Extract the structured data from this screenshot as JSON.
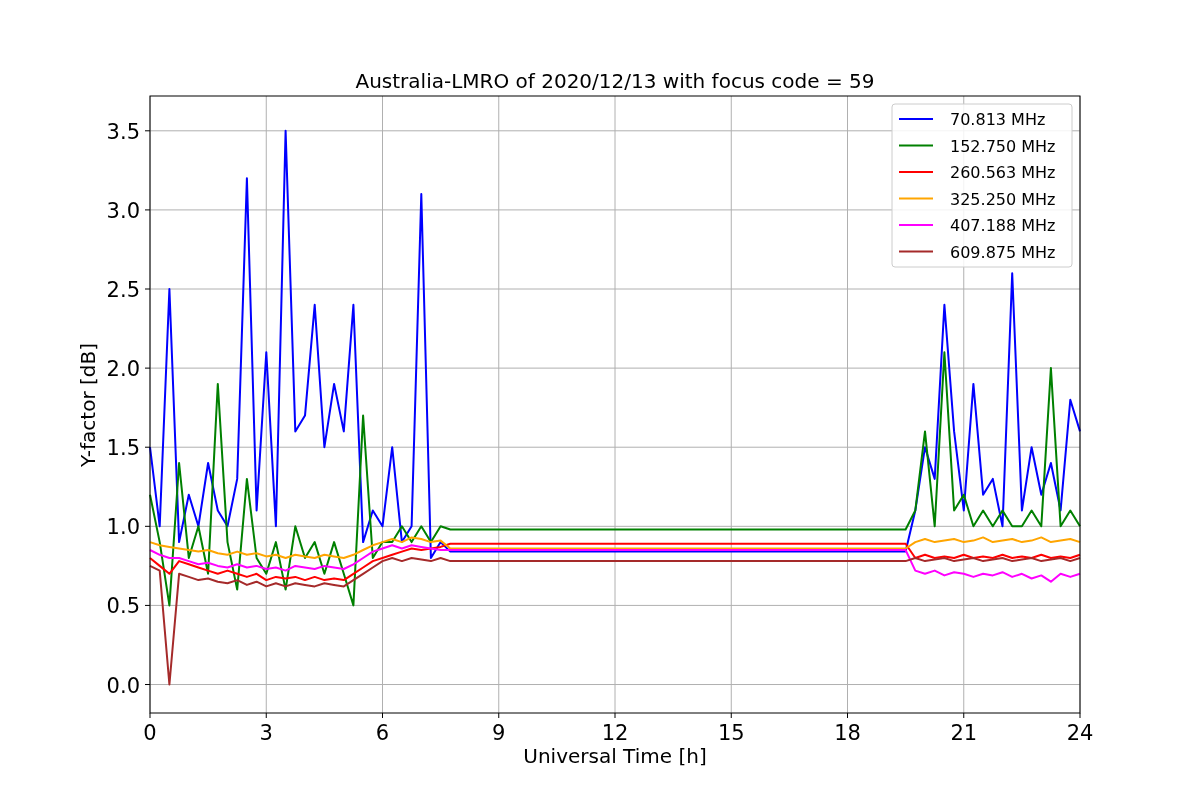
{
  "chart_data": {
    "type": "line",
    "title": "Australia-LMRO of 2020/12/13 with focus code = 59",
    "xlabel": "Universal Time [h]",
    "ylabel": "Y-factor [dB]",
    "x": [
      0,
      0.25,
      0.5,
      0.75,
      1,
      1.25,
      1.5,
      1.75,
      2,
      2.25,
      2.5,
      2.75,
      3,
      3.25,
      3.5,
      3.75,
      4,
      4.25,
      4.5,
      4.75,
      5,
      5.25,
      5.5,
      5.75,
      6,
      6.25,
      6.5,
      6.75,
      7,
      7.25,
      7.5,
      7.75,
      19.5,
      19.75,
      20,
      20.25,
      20.5,
      20.75,
      21,
      21.25,
      21.5,
      21.75,
      22,
      22.25,
      22.5,
      22.75,
      23,
      23.25,
      23.5,
      23.75,
      24
    ],
    "series": [
      {
        "name": "70.813 MHz",
        "color": "#0000ff",
        "values": [
          1.5,
          1.0,
          2.5,
          0.9,
          1.2,
          1.0,
          1.4,
          1.1,
          1.0,
          1.3,
          3.2,
          1.1,
          2.1,
          1.0,
          3.5,
          1.6,
          1.7,
          2.4,
          1.5,
          1.9,
          1.6,
          2.4,
          0.9,
          1.1,
          1.0,
          1.5,
          0.9,
          1.0,
          3.1,
          0.8,
          0.9,
          0.84,
          0.84,
          1.1,
          1.5,
          1.3,
          2.4,
          1.6,
          1.1,
          1.9,
          1.2,
          1.3,
          1.0,
          2.6,
          1.1,
          1.5,
          1.2,
          1.4,
          1.1,
          1.8,
          1.6
        ]
      },
      {
        "name": "152.750 MHz",
        "color": "#008000",
        "values": [
          1.2,
          0.9,
          0.5,
          1.4,
          0.8,
          1.0,
          0.7,
          1.9,
          0.9,
          0.6,
          1.3,
          0.8,
          0.7,
          0.9,
          0.6,
          1.0,
          0.8,
          0.9,
          0.7,
          0.9,
          0.7,
          0.5,
          1.7,
          0.8,
          0.9,
          0.9,
          1.0,
          0.9,
          1.0,
          0.9,
          1.0,
          0.98,
          0.98,
          1.1,
          1.6,
          1.0,
          2.1,
          1.1,
          1.2,
          1.0,
          1.1,
          1.0,
          1.1,
          1.0,
          1.0,
          1.1,
          1.0,
          2.0,
          1.0,
          1.1,
          1.0
        ]
      },
      {
        "name": "260.563 MHz",
        "color": "#ff0000",
        "values": [
          0.8,
          0.75,
          0.7,
          0.78,
          0.76,
          0.74,
          0.72,
          0.7,
          0.72,
          0.7,
          0.68,
          0.7,
          0.66,
          0.68,
          0.67,
          0.68,
          0.66,
          0.68,
          0.66,
          0.67,
          0.66,
          0.7,
          0.74,
          0.78,
          0.8,
          0.82,
          0.84,
          0.86,
          0.85,
          0.86,
          0.87,
          0.89,
          0.89,
          0.8,
          0.82,
          0.8,
          0.81,
          0.8,
          0.82,
          0.8,
          0.81,
          0.8,
          0.82,
          0.8,
          0.81,
          0.8,
          0.82,
          0.8,
          0.81,
          0.8,
          0.82
        ]
      },
      {
        "name": "325.250 MHz",
        "color": "#ffa500",
        "values": [
          0.9,
          0.88,
          0.87,
          0.86,
          0.85,
          0.84,
          0.85,
          0.83,
          0.82,
          0.84,
          0.82,
          0.83,
          0.81,
          0.82,
          0.8,
          0.82,
          0.81,
          0.8,
          0.82,
          0.81,
          0.8,
          0.82,
          0.85,
          0.88,
          0.9,
          0.92,
          0.9,
          0.93,
          0.92,
          0.9,
          0.91,
          0.86,
          0.86,
          0.9,
          0.92,
          0.9,
          0.91,
          0.92,
          0.9,
          0.91,
          0.93,
          0.9,
          0.91,
          0.92,
          0.9,
          0.91,
          0.93,
          0.9,
          0.91,
          0.92,
          0.9
        ]
      },
      {
        "name": "407.188 MHz",
        "color": "#ff00ff",
        "values": [
          0.85,
          0.82,
          0.8,
          0.8,
          0.78,
          0.76,
          0.77,
          0.75,
          0.74,
          0.76,
          0.74,
          0.75,
          0.73,
          0.74,
          0.72,
          0.75,
          0.74,
          0.73,
          0.75,
          0.74,
          0.73,
          0.76,
          0.8,
          0.84,
          0.86,
          0.88,
          0.86,
          0.88,
          0.87,
          0.86,
          0.85,
          0.85,
          0.85,
          0.72,
          0.7,
          0.72,
          0.69,
          0.71,
          0.7,
          0.68,
          0.7,
          0.69,
          0.71,
          0.68,
          0.7,
          0.67,
          0.69,
          0.65,
          0.7,
          0.68,
          0.7
        ]
      },
      {
        "name": "609.875 MHz",
        "color": "#a52a2a",
        "values": [
          0.75,
          0.72,
          0.0,
          0.7,
          0.68,
          0.66,
          0.67,
          0.65,
          0.64,
          0.66,
          0.63,
          0.65,
          0.62,
          0.64,
          0.62,
          0.64,
          0.63,
          0.62,
          0.64,
          0.63,
          0.62,
          0.66,
          0.7,
          0.74,
          0.78,
          0.8,
          0.78,
          0.8,
          0.79,
          0.78,
          0.8,
          0.78,
          0.78,
          0.8,
          0.78,
          0.79,
          0.8,
          0.78,
          0.79,
          0.8,
          0.78,
          0.79,
          0.8,
          0.78,
          0.79,
          0.8,
          0.78,
          0.79,
          0.8,
          0.78,
          0.8
        ]
      }
    ],
    "grid": true,
    "legend": true,
    "xlim": [
      0,
      24
    ],
    "ylim": [
      -0.18,
      3.72
    ],
    "xticks": [
      0,
      3,
      6,
      9,
      12,
      15,
      18,
      21,
      24
    ],
    "yticks": [
      {
        "value": 0,
        "label": "0.0"
      },
      {
        "value": 0.5,
        "label": "0.5"
      },
      {
        "value": 1,
        "label": "1.0"
      },
      {
        "value": 1.5,
        "label": "1.5"
      },
      {
        "value": 2,
        "label": "2.0"
      },
      {
        "value": 2.5,
        "label": "2.5"
      },
      {
        "value": 3,
        "label": "3.0"
      },
      {
        "value": 3.5,
        "label": "3.5"
      }
    ]
  }
}
